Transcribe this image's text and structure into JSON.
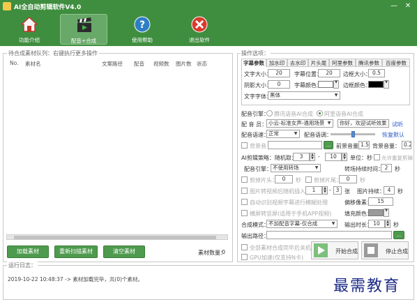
{
  "window": {
    "title": "AI全自动剪辑软件V4.0",
    "minimize": "—",
    "close": "✕"
  },
  "toolbar": [
    {
      "label": "功能介绍",
      "icon": "home-icon"
    },
    {
      "label": "配音+合成",
      "icon": "clapperboard-icon"
    },
    {
      "label": "使用帮助",
      "icon": "help-icon"
    },
    {
      "label": "退出软件",
      "icon": "exit-icon"
    }
  ],
  "queue": {
    "legend": "待合成素材队列：右键执行更多操作",
    "columns": [
      "No.",
      "素材名",
      "文案路径",
      "配音",
      "视频数",
      "图片数",
      "状态"
    ],
    "buttons": {
      "load": "加载素材",
      "rescan": "重新扫描素材",
      "clear": "清空素材"
    },
    "count_label": "素材数量：",
    "count_value": "0"
  },
  "options": {
    "legend": "操作选项：",
    "tabs": [
      "字幕参数",
      "加水印",
      "去水印",
      "片头尾",
      "阿里参数",
      "腾讯参数",
      "百度参数"
    ],
    "subtitle": {
      "font_size_label": "文字大小：",
      "font_size": "20",
      "position_label": "字幕位置：",
      "position": "20",
      "border_size_label": "边框大小：",
      "border_size": "0.5",
      "shadow_label": "阴影大小：",
      "shadow": "0",
      "color_label": "字幕颜色：",
      "border_color_label": "边框颜色：",
      "font_label": "文字字体：",
      "font": "黑体"
    },
    "engine": {
      "label": "配音引擎：",
      "opt1": "腾讯语音AI合成",
      "opt2": "阿里语音AI合成"
    },
    "voicer": {
      "label": "配 音 员：",
      "value": "小云-标准女声-通用场景",
      "sample": "你好，欢迎试听效果",
      "listen": "试听"
    },
    "speed": {
      "label": "配音语速：",
      "value": "正常",
      "tone_label": "配音语调：",
      "reset": "恢复默认"
    },
    "bgm": {
      "label": "背景音",
      "front_label": "前景音量：",
      "front": "1.5",
      "back_label": "背景音量：",
      "back": "0.2"
    },
    "clip": {
      "label": "AI剪辑策略：随机取：",
      "min": "3",
      "max": "10",
      "unit": "单位：秒",
      "allow": "允许重复剪辑"
    },
    "transition": {
      "label": "配音引擎：",
      "value": "不使用转场",
      "dur_label": "转场持续时间：",
      "dur": "2",
      "unit": "秒"
    },
    "cut": {
      "head_label": "剪掉片头：",
      "head": "0",
      "tail_label": "剪掉片尾：",
      "tail": "0",
      "unit": "秒"
    },
    "img": {
      "label": "图片转视频后随机插入",
      "min": "1",
      "max": "3",
      "unit": "张",
      "dur_label": "图片持续：",
      "dur": "4",
      "sec": "秒"
    },
    "auto": {
      "label": "自动识别视频字幕进行模糊处理",
      "blur_label": "偏移像素：",
      "blur": "15"
    },
    "vertical": {
      "label": "横屏转竖屏(适用于手机APP视频)",
      "fill_label": "填充颜色："
    },
    "mode": {
      "label": "合成模式：",
      "value": "不加配音字幕-仅合成",
      "dur_label": "输出时长：",
      "dur": "10",
      "unit": "秒"
    },
    "output": {
      "label": "输出路径：",
      "browse": "..."
    },
    "shutdown": {
      "label": "全部素材合成完毕后关机"
    },
    "gpu": {
      "label": "GPU加速(仅支持N卡)"
    },
    "start": "开始合成",
    "stop": "停止合成"
  },
  "log": {
    "legend": "运行日志：",
    "line": "2019-10-22 10:48:37 -> 素材加载完毕，共(0)个素材。"
  },
  "watermark": "最需教育",
  "colors": {
    "brand_green": "#3f8e3f",
    "accent_blue": "#2a59c9"
  }
}
